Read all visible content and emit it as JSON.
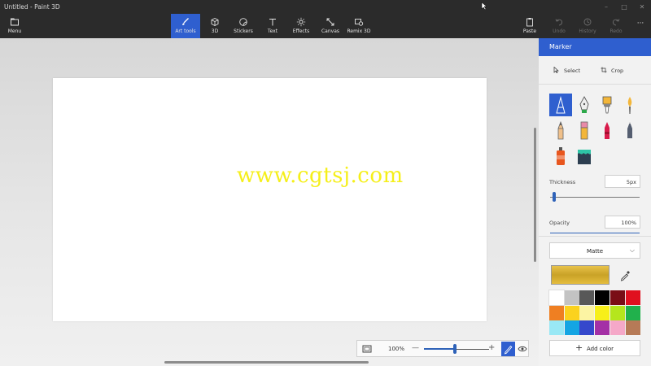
{
  "window": {
    "title": "Untitled - Paint 3D"
  },
  "toolbar": {
    "menu_label": "Menu",
    "tools": [
      {
        "label": "Art tools",
        "icon": "brush-icon",
        "active": true
      },
      {
        "label": "3D",
        "icon": "cube-icon"
      },
      {
        "label": "Stickers",
        "icon": "sticker-icon"
      },
      {
        "label": "Text",
        "icon": "text-icon"
      },
      {
        "label": "Effects",
        "icon": "effects-icon"
      },
      {
        "label": "Canvas",
        "icon": "canvas-icon"
      },
      {
        "label": "Remix 3D",
        "icon": "remix-icon"
      }
    ],
    "actions": [
      {
        "label": "Paste",
        "icon": "paste-icon",
        "enabled": true
      },
      {
        "label": "Undo",
        "icon": "undo-icon",
        "enabled": false
      },
      {
        "label": "History",
        "icon": "history-icon",
        "enabled": false
      },
      {
        "label": "Redo",
        "icon": "redo-icon",
        "enabled": false
      }
    ],
    "more_label": "···"
  },
  "canvas": {
    "watermark": "www.cgtsj.com",
    "watermark_color": "#f5ef1a"
  },
  "zoom": {
    "value": "100%",
    "minus": "—",
    "plus": "+"
  },
  "panel": {
    "title": "Marker",
    "select_label": "Select",
    "crop_label": "Crop",
    "brushes": [
      {
        "name": "marker",
        "selected": true
      },
      {
        "name": "calligraphy-pen"
      },
      {
        "name": "oil-brush"
      },
      {
        "name": "watercolor"
      },
      {
        "name": "pencil"
      },
      {
        "name": "eraser"
      },
      {
        "name": "crayon"
      },
      {
        "name": "pixel-pen"
      },
      {
        "name": "spray-can"
      },
      {
        "name": "fill"
      }
    ],
    "thickness": {
      "label": "Thickness",
      "value": "5px",
      "level": 0.03
    },
    "opacity": {
      "label": "Opacity",
      "value": "100%",
      "level": 1.0
    },
    "finish": {
      "value": "Matte"
    },
    "current_color": "#d4ad30",
    "palette": [
      "#ffffff",
      "#c3c3c3",
      "#585858",
      "#000000",
      "#7a0d16",
      "#e0101f",
      "#ef7f22",
      "#fbd21e",
      "#fcf4a3",
      "#f7ef19",
      "#b5e61d",
      "#21b14c",
      "#99e8f5",
      "#14a5e3",
      "#3548cc",
      "#a430a6",
      "#f5a8c8",
      "#b67a57"
    ],
    "add_color_label": "Add color"
  },
  "colors": {
    "accent": "#2f5fcf",
    "chrome": "#2b2b2b"
  }
}
